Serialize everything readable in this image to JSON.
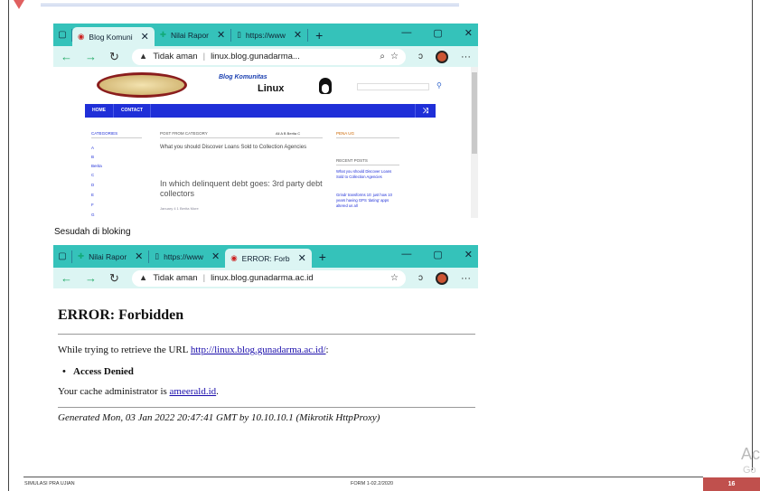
{
  "browser1": {
    "tabs": [
      {
        "label": "Blog Komuni",
        "active": true
      },
      {
        "label": "Nilai Rapor",
        "active": false
      },
      {
        "label": "https://www",
        "active": false
      }
    ],
    "address_warning": "Tidak aman",
    "url": "linux.blog.gunadarma...",
    "blog": {
      "title_line1": "Blog Komunitas",
      "title_line2": "Linux",
      "menu": [
        "HOME",
        "CONTACT"
      ],
      "categories_heading": "CATEGORIES",
      "categories": [
        "A",
        "B",
        "Berita",
        "C",
        "D",
        "E",
        "F",
        "G"
      ],
      "post_heading": "POST FROM CATEGORY",
      "filters": "All  A  B  Berita  C",
      "post_small": "What you should Discover Loans Sold to Collection Agencies",
      "post_big": "In which delinquent debt goes: 3rd party debt collectors",
      "post_meta": "January 4   1   Berita   More",
      "pena_heading": "PENA UG",
      "recent_heading": "RECENT POSTS",
      "recent": [
        "What you should Discover Loans Sold to Collection Agencies",
        "Grindr transforms 10: just how 10 years having GPS 'dating' apps altered us all"
      ]
    }
  },
  "caption": "Sesudah di bloking",
  "browser2": {
    "tabs": [
      {
        "label": "Nilai Rapor",
        "active": false
      },
      {
        "label": "https://www",
        "active": false
      },
      {
        "label": "ERROR: Forb",
        "active": true
      }
    ],
    "address_warning": "Tidak aman",
    "url": "linux.blog.gunadarma.ac.id",
    "error": {
      "title": "ERROR: Forbidden",
      "retrieve_prefix": "While trying to retrieve the URL ",
      "retrieve_url": "http://linux.blog.gunadarma.ac.id/",
      "retrieve_suffix": ":",
      "bullet": "Access Denied",
      "admin_prefix": "Your cache administrator is ",
      "admin_link": "ameerald.id",
      "admin_suffix": ".",
      "generated": "Generated Mon, 03 Jan 2022 20:47:41 GMT by 10.10.10.1 (Mikrotik HttpProxy)"
    }
  },
  "footer": {
    "left": "SIMULASI PRA UJIAN",
    "middle": "FORM 1-02.2/2020",
    "page": "16"
  },
  "watermark": "Ac",
  "watermark2": "Go",
  "colors": {
    "tabbar": "#35c2ba",
    "addressbar": "#dcf5f3",
    "blog_menu": "#1f2fd8",
    "footer_badge": "#c0504d"
  }
}
